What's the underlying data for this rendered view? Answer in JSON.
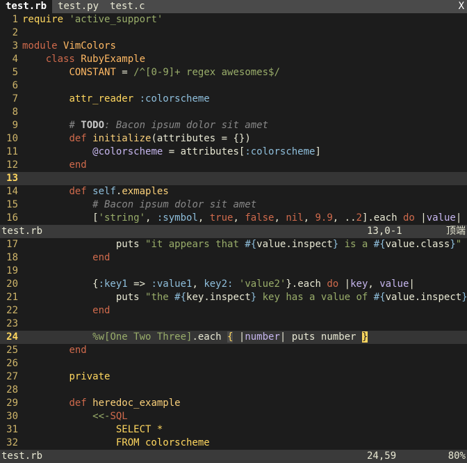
{
  "tabs": [
    {
      "label": "test.rb",
      "active": true
    },
    {
      "label": "test.py",
      "active": false
    },
    {
      "label": "test.c",
      "active": false
    }
  ],
  "tab_close_label": "X",
  "top_pane": {
    "lines": [
      {
        "n": "1",
        "segs": [
          [
            "kw2",
            "require "
          ],
          [
            "str",
            "'active_support'"
          ]
        ]
      },
      {
        "n": "2",
        "segs": []
      },
      {
        "n": "3",
        "segs": [
          [
            "kw",
            "module "
          ],
          [
            "const",
            "VimColors"
          ]
        ]
      },
      {
        "n": "4",
        "segs": [
          [
            "plain",
            "    "
          ],
          [
            "kw",
            "class "
          ],
          [
            "const",
            "RubyExample"
          ]
        ]
      },
      {
        "n": "5",
        "segs": [
          [
            "plain",
            "        "
          ],
          [
            "const",
            "CONSTANT"
          ],
          [
            "plain",
            " = "
          ],
          [
            "str",
            "/^[0-9]+ regex awesomes$/"
          ]
        ]
      },
      {
        "n": "6",
        "segs": []
      },
      {
        "n": "7",
        "segs": [
          [
            "plain",
            "        "
          ],
          [
            "kw2",
            "attr_reader "
          ],
          [
            "sym",
            ":colorscheme"
          ]
        ]
      },
      {
        "n": "8",
        "segs": []
      },
      {
        "n": "9",
        "segs": [
          [
            "plain",
            "        "
          ],
          [
            "cmt",
            "# "
          ],
          [
            "todo",
            "TODO"
          ],
          [
            "cmt",
            ": Bacon ipsum dolor sit amet"
          ]
        ]
      },
      {
        "n": "10",
        "segs": [
          [
            "plain",
            "        "
          ],
          [
            "kw",
            "def "
          ],
          [
            "fn",
            "initialize"
          ],
          [
            "plain",
            "(attributes = {})"
          ]
        ]
      },
      {
        "n": "11",
        "segs": [
          [
            "plain",
            "            "
          ],
          [
            "ivar",
            "@colorscheme"
          ],
          [
            "plain",
            " = attributes["
          ],
          [
            "sym",
            ":colorscheme"
          ],
          [
            "plain",
            "]"
          ]
        ]
      },
      {
        "n": "12",
        "segs": [
          [
            "plain",
            "        "
          ],
          [
            "kw",
            "end"
          ]
        ]
      },
      {
        "n": "13",
        "cursor": true,
        "segs": []
      },
      {
        "n": "14",
        "segs": [
          [
            "plain",
            "        "
          ],
          [
            "kw",
            "def "
          ],
          [
            "sym",
            "self"
          ],
          [
            "plain",
            "."
          ],
          [
            "fn",
            "exmaples"
          ]
        ]
      },
      {
        "n": "15",
        "segs": [
          [
            "plain",
            "            "
          ],
          [
            "cmt",
            "# Bacon ipsum dolor sit amet"
          ]
        ]
      },
      {
        "n": "16",
        "segs": [
          [
            "plain",
            "            ["
          ],
          [
            "str",
            "'string'"
          ],
          [
            "plain",
            ", "
          ],
          [
            "sym",
            ":symbol"
          ],
          [
            "plain",
            ", "
          ],
          [
            "num",
            "true"
          ],
          [
            "plain",
            ", "
          ],
          [
            "num",
            "false"
          ],
          [
            "plain",
            ", "
          ],
          [
            "num",
            "nil"
          ],
          [
            "plain",
            ", "
          ],
          [
            "num",
            "9.9"
          ],
          [
            "plain",
            ", .."
          ],
          [
            "num",
            "2"
          ],
          [
            "plain",
            "].each "
          ],
          [
            "kw",
            "do"
          ],
          [
            "plain",
            " |"
          ],
          [
            "ivar",
            "value"
          ],
          [
            "plain",
            "|"
          ]
        ]
      }
    ]
  },
  "top_status": {
    "file": "test.rb",
    "position": "13,0-1",
    "scroll": "顶端"
  },
  "bottom_pane": {
    "lines": [
      {
        "n": "17",
        "segs": [
          [
            "plain",
            "                puts "
          ],
          [
            "str",
            "\"it appears that "
          ],
          [
            "interp",
            "#{"
          ],
          [
            "plain",
            "value.inspect"
          ],
          [
            "interp",
            "}"
          ],
          [
            "str",
            " is a "
          ],
          [
            "interp",
            "#{"
          ],
          [
            "plain",
            "value.class"
          ],
          [
            "interp",
            "}"
          ],
          [
            "str",
            "\""
          ]
        ]
      },
      {
        "n": "18",
        "segs": [
          [
            "plain",
            "            "
          ],
          [
            "kw",
            "end"
          ]
        ]
      },
      {
        "n": "19",
        "segs": []
      },
      {
        "n": "20",
        "segs": [
          [
            "plain",
            "            {"
          ],
          [
            "sym",
            ":key1"
          ],
          [
            "plain",
            " => "
          ],
          [
            "sym",
            ":value1"
          ],
          [
            "plain",
            ", "
          ],
          [
            "sym",
            "key2:"
          ],
          [
            "plain",
            " "
          ],
          [
            "str",
            "'value2'"
          ],
          [
            "plain",
            "}.each "
          ],
          [
            "kw",
            "do"
          ],
          [
            "plain",
            " |"
          ],
          [
            "ivar",
            "key"
          ],
          [
            "plain",
            ", "
          ],
          [
            "ivar",
            "value"
          ],
          [
            "plain",
            "|"
          ]
        ]
      },
      {
        "n": "21",
        "segs": [
          [
            "plain",
            "                puts "
          ],
          [
            "str",
            "\"the "
          ],
          [
            "interp",
            "#{"
          ],
          [
            "plain",
            "key.inspect"
          ],
          [
            "interp",
            "}"
          ],
          [
            "str",
            " key has a value of "
          ],
          [
            "interp",
            "#{"
          ],
          [
            "plain",
            "value.inspect"
          ],
          [
            "interp",
            "}"
          ],
          [
            "str",
            "\""
          ]
        ]
      },
      {
        "n": "22",
        "segs": [
          [
            "plain",
            "            "
          ],
          [
            "kw",
            "end"
          ]
        ]
      },
      {
        "n": "23",
        "segs": []
      },
      {
        "n": "24",
        "cursor": true,
        "segs": [
          [
            "plain",
            "            "
          ],
          [
            "str",
            "%w[One Two Three]"
          ],
          [
            "plain",
            ".each "
          ],
          [
            "brace-hl",
            "{"
          ],
          [
            "plain",
            " |"
          ],
          [
            "ivar",
            "number"
          ],
          [
            "plain",
            "| puts number "
          ],
          [
            "brace-hl2",
            "}"
          ]
        ]
      },
      {
        "n": "25",
        "segs": [
          [
            "plain",
            "        "
          ],
          [
            "kw",
            "end"
          ]
        ]
      },
      {
        "n": "26",
        "segs": []
      },
      {
        "n": "27",
        "segs": [
          [
            "plain",
            "        "
          ],
          [
            "kw2",
            "private"
          ]
        ]
      },
      {
        "n": "28",
        "segs": []
      },
      {
        "n": "29",
        "segs": [
          [
            "plain",
            "        "
          ],
          [
            "kw",
            "def "
          ],
          [
            "fn",
            "heredoc_example"
          ]
        ]
      },
      {
        "n": "30",
        "segs": [
          [
            "plain",
            "            "
          ],
          [
            "str",
            "<<-"
          ],
          [
            "kw",
            "SQL"
          ]
        ]
      },
      {
        "n": "31",
        "segs": [
          [
            "plain",
            "                "
          ],
          [
            "kw2",
            "SELECT *"
          ]
        ]
      },
      {
        "n": "32",
        "segs": [
          [
            "plain",
            "                "
          ],
          [
            "kw2",
            "FROM colorscheme"
          ]
        ]
      }
    ]
  },
  "bottom_status": {
    "file": "test.rb",
    "position": "24,59",
    "scroll": "80%"
  }
}
